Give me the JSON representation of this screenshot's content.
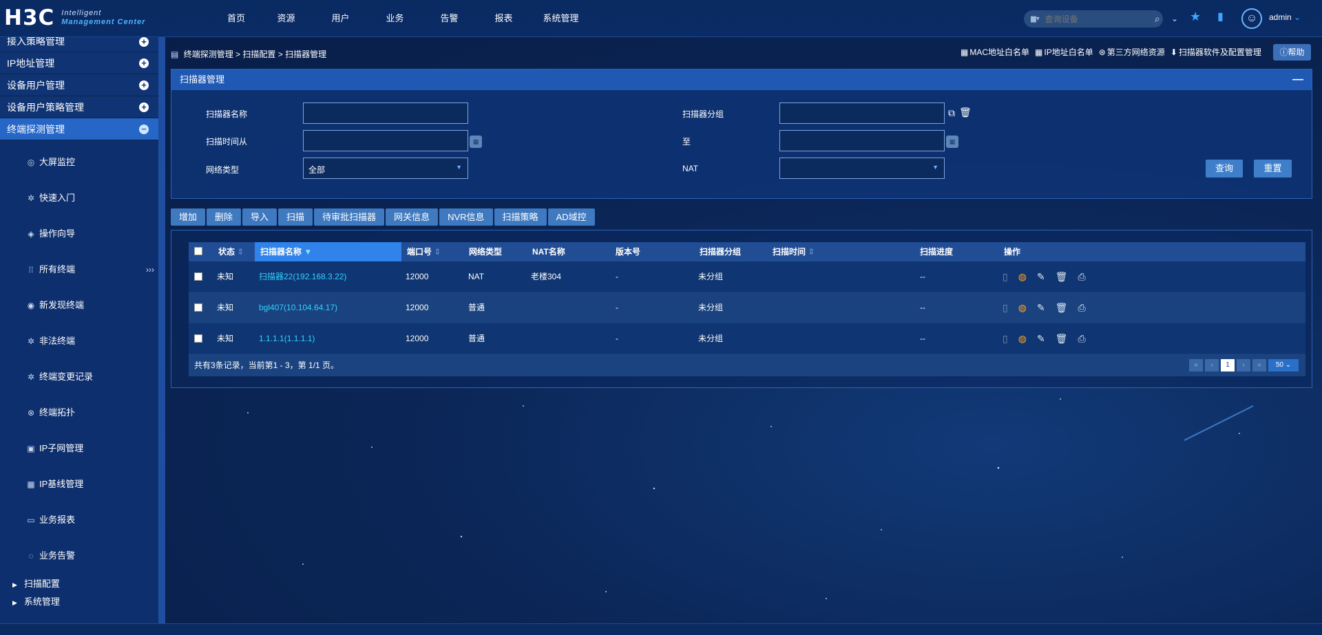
{
  "app": {
    "logo": "H3C",
    "product_line1": "Intelligent",
    "product_line2": "Management Center"
  },
  "nav": {
    "items": [
      "首页",
      "资源",
      "用户",
      "业务",
      "告警",
      "报表",
      "系统管理"
    ],
    "search_placeholder": "查询设备",
    "user": "admin"
  },
  "sidebar": {
    "groups": [
      {
        "label": "接入策略管理",
        "state": "collapsed"
      },
      {
        "label": "IP地址管理",
        "state": "collapsed"
      },
      {
        "label": "设备用户管理",
        "state": "collapsed"
      },
      {
        "label": "设备用户策略管理",
        "state": "collapsed"
      },
      {
        "label": "终端探测管理",
        "state": "expanded"
      }
    ],
    "items": [
      {
        "label": "大屏监控",
        "icon": "monitor-icon"
      },
      {
        "label": "快速入门",
        "icon": "network-icon"
      },
      {
        "label": "操作向导",
        "icon": "wizard-icon"
      },
      {
        "label": "所有终端",
        "icon": "grid-icon",
        "expand": "›››"
      },
      {
        "label": "新发现终端",
        "icon": "radar-icon"
      },
      {
        "label": "非法终端",
        "icon": "network-icon"
      },
      {
        "label": "终端变更记录",
        "icon": "network-icon"
      },
      {
        "label": "终端拓扑",
        "icon": "topology-icon"
      },
      {
        "label": "IP子网管理",
        "icon": "subnet-icon"
      },
      {
        "label": "IP基线管理",
        "icon": "baseline-icon"
      },
      {
        "label": "业务报表",
        "icon": "report-icon"
      },
      {
        "label": "业务告警",
        "icon": "alarm-icon"
      }
    ],
    "subgroups": [
      "扫描配置",
      "系统管理"
    ]
  },
  "breadcrumb": {
    "items": [
      "终端探测管理",
      "扫描配置",
      "扫描器管理"
    ],
    "separator": ">"
  },
  "top_links": [
    "MAC地址白名单",
    "IP地址白名单",
    "第三方网络资源",
    "扫描器软件及配置管理"
  ],
  "help_label": "帮助",
  "filter_panel": {
    "title": "扫描器管理",
    "collapse_symbol": "—",
    "fields": {
      "scanner_name": {
        "label": "扫描器名称",
        "value": ""
      },
      "scanner_group": {
        "label": "扫描器分组",
        "value": ""
      },
      "scan_time_from": {
        "label": "扫描时间从",
        "value": ""
      },
      "scan_time_to": {
        "label": "至",
        "value": ""
      },
      "network_type": {
        "label": "网络类型",
        "value": "全部"
      },
      "nat": {
        "label": "NAT",
        "value": ""
      }
    },
    "query_label": "查询",
    "reset_label": "重置"
  },
  "toolbar": [
    "增加",
    "删除",
    "导入",
    "扫描",
    "待审批扫描器",
    "网关信息",
    "NVR信息",
    "扫描策略",
    "AD域控"
  ],
  "table": {
    "columns": [
      "状态",
      "扫描器名称",
      "端口号",
      "网络类型",
      "NAT名称",
      "版本号",
      "扫描器分组",
      "扫描时间",
      "扫描进度",
      "操作"
    ],
    "sorted_column": "扫描器名称",
    "rows": [
      {
        "status": "未知",
        "name": "扫描器22(192.168.3.22)",
        "port": "12000",
        "net_type": "NAT",
        "nat_name": "老楼304",
        "version": "-",
        "group": "未分组",
        "scan_time": "",
        "progress": "--"
      },
      {
        "status": "未知",
        "name": "bgl407(10.104.64.17)",
        "port": "12000",
        "net_type": "普通",
        "nat_name": "",
        "version": "-",
        "group": "未分组",
        "scan_time": "",
        "progress": "--"
      },
      {
        "status": "未知",
        "name": "1.1.1.1(1.1.1.1)",
        "port": "12000",
        "net_type": "普通",
        "nat_name": "",
        "version": "-",
        "group": "未分组",
        "scan_time": "",
        "progress": "--"
      }
    ],
    "footer_info": "共有3条记录，当前第1 - 3，第 1/1 页。",
    "current_page": "1",
    "page_size": "50"
  },
  "colors": {
    "topbar": "#0a2a62",
    "sidebar": "#0e2f6e",
    "accent": "#2f83ea",
    "link": "#35d1ff",
    "star": "#39a7ff"
  }
}
